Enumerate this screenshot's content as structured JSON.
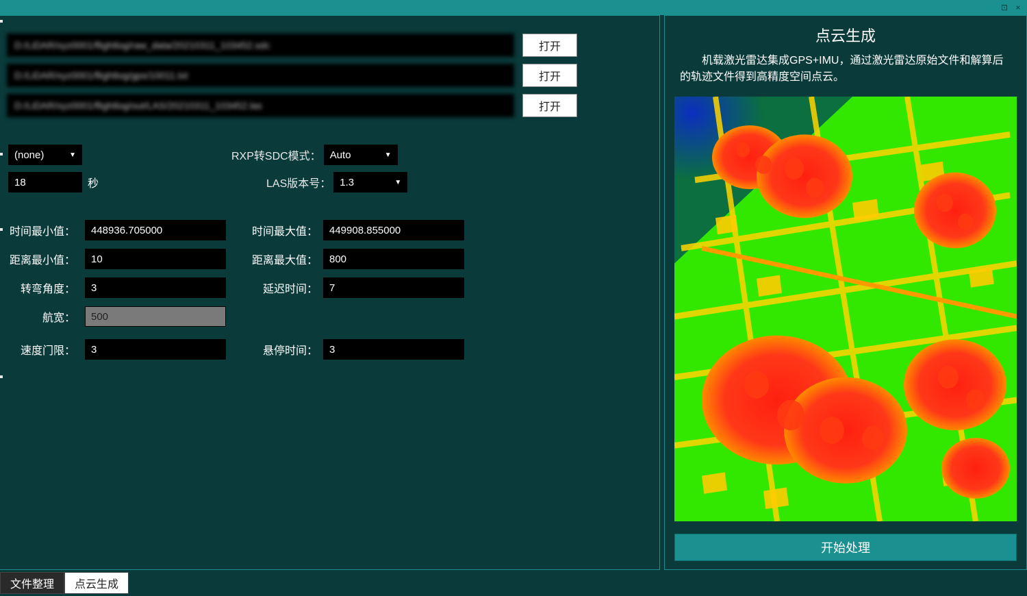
{
  "window": {
    "dock_icon": "⊡",
    "close_icon": "×"
  },
  "files": {
    "path1": "D:/LiDAR/xyz0001/flightlog/raw_data/20210311_103452.sdc",
    "path2": "D:/LiDAR/xyz0001/flightlog/gps/10011.txt",
    "path3": "D:/LiDAR/xyz0001/flightlog/out/LAS/20210311_103452.las",
    "open_label": "打开"
  },
  "settings": {
    "select1_value": "(none)",
    "rxp_label": "RXP转SDC模式：",
    "rxp_value": "Auto",
    "gps_value": "18",
    "gps_suffix": "秒",
    "las_label": "LAS版本号：",
    "las_value": "1.3"
  },
  "params": {
    "time_min_label": "时间最小值：",
    "time_min_value": "448936.705000",
    "time_max_label": "时间最大值：",
    "time_max_value": "449908.855000",
    "dist_min_label": "距离最小值：",
    "dist_min_value": "10",
    "dist_max_label": "距离最大值：",
    "dist_max_value": "800",
    "turn_angle_label": "转弯角度：",
    "turn_angle_value": "3",
    "delay_label": "延迟时间：",
    "delay_value": "7",
    "swath_label": "航宽：",
    "swath_value": "500",
    "speed_label": "速度门限：",
    "speed_value": "3",
    "hover_label": "悬停时间：",
    "hover_value": "3"
  },
  "right": {
    "title": "点云生成",
    "desc": "机载激光雷达集成GPS+IMU，通过激光雷达原始文件和解算后的轨迹文件得到高精度空间点云。",
    "start": "开始处理"
  },
  "tabs": {
    "tab1": "文件整理",
    "tab2": "点云生成"
  }
}
